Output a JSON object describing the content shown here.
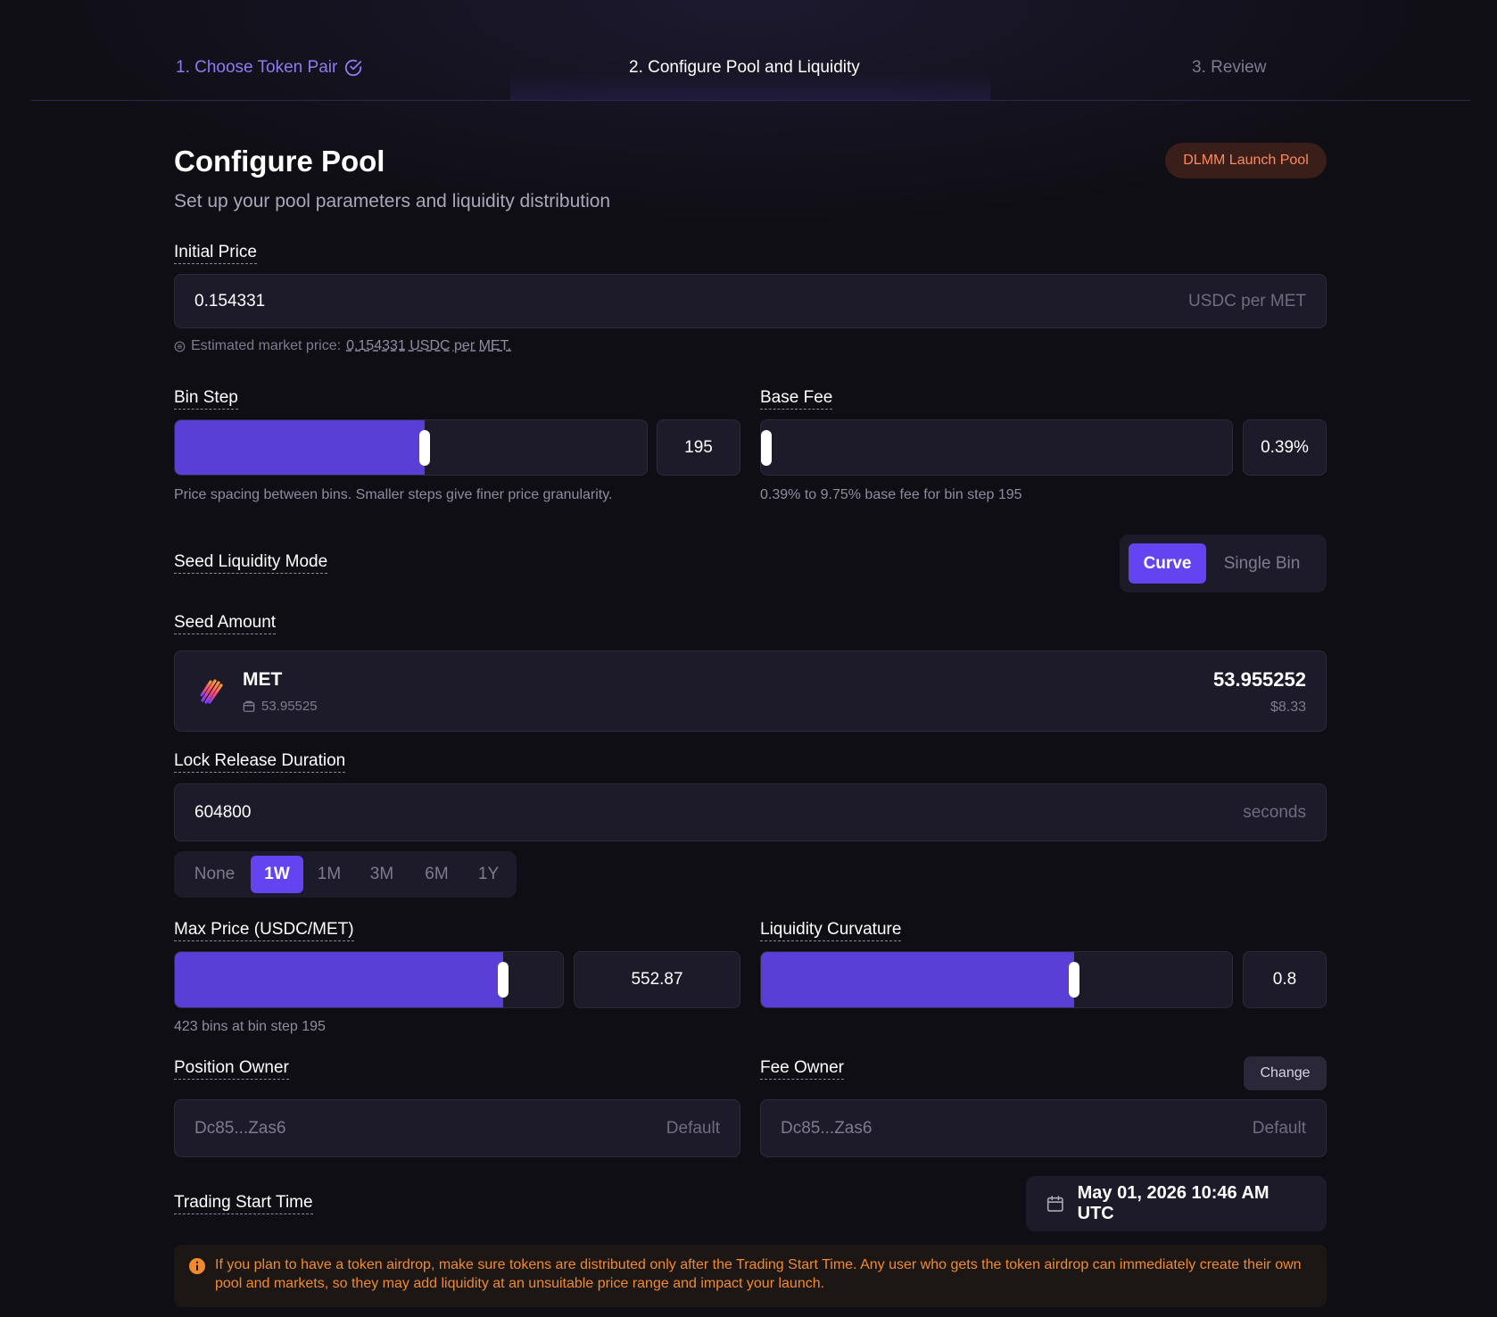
{
  "stepper": {
    "step1": "1. Choose Token Pair",
    "step2": "2. Configure Pool and Liquidity",
    "step3": "3. Review"
  },
  "header": {
    "title": "Configure Pool",
    "subtitle": "Set up your pool parameters and liquidity distribution",
    "badge": "DLMM Launch Pool"
  },
  "initial_price": {
    "label": "Initial Price",
    "value": "0.154331",
    "unit": "USDC per MET",
    "hint_prefix": "Estimated market price:",
    "hint_value": "0.154331 USDC per MET."
  },
  "bin_step": {
    "label": "Bin Step",
    "value": "195",
    "fill_fraction": 0.53,
    "hint": "Price spacing between bins. Smaller steps give finer price granularity."
  },
  "base_fee": {
    "label": "Base Fee",
    "value": "0.39%",
    "fill_fraction": 0.0,
    "hint": "0.39% to 9.75% base fee for bin step 195"
  },
  "seed_mode": {
    "label": "Seed Liquidity Mode",
    "options": [
      "Curve",
      "Single Bin"
    ],
    "selected": "Curve"
  },
  "seed_amount": {
    "label": "Seed Amount",
    "token": "MET",
    "balance": "53.95525",
    "amount": "53.955252",
    "usd": "$8.33"
  },
  "lock_release": {
    "label": "Lock Release Duration",
    "value": "604800",
    "unit": "seconds",
    "presets": [
      "None",
      "1W",
      "1M",
      "3M",
      "6M",
      "1Y"
    ],
    "selected": "1W"
  },
  "max_price": {
    "label": "Max Price (USDC/MET)",
    "value": "552.87",
    "fill_fraction": 0.845,
    "hint": "423 bins at bin step 195"
  },
  "curvature": {
    "label": "Liquidity Curvature",
    "value": "0.8",
    "fill_fraction": 0.665
  },
  "position_owner": {
    "label": "Position Owner",
    "address": "Dc85...Zas6",
    "tag": "Default"
  },
  "fee_owner": {
    "label": "Fee Owner",
    "address": "Dc85...Zas6",
    "tag": "Default",
    "change_label": "Change"
  },
  "trading_start": {
    "label": "Trading Start Time",
    "value": "May 01, 2026 10:46 AM UTC"
  },
  "warning": {
    "text": "If you plan to have a token airdrop, make sure tokens are distributed only after the Trading Start Time. Any user who gets the token airdrop can immediately create their own pool and markets, so they may add liquidity at an unsuitable price range and impact your launch."
  },
  "colors": {
    "accent": "#6344f0",
    "slider_fill": "#5a3fd6",
    "badge_text": "#ff8a5c",
    "warning": "#f08a30",
    "background": "#0f0e14"
  },
  "icons": {
    "step1": "check-circle-icon",
    "token": "met-token-logo",
    "balance": "wallet-icon",
    "date": "calendar-icon",
    "warning": "info-icon"
  }
}
